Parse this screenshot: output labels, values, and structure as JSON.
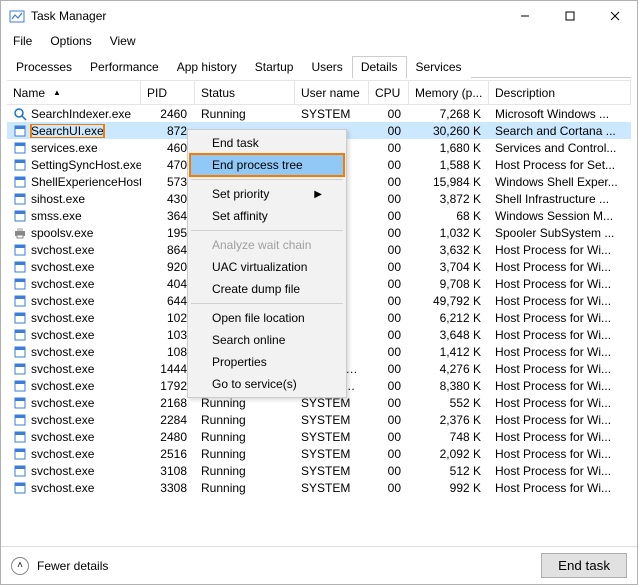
{
  "title": "Task Manager",
  "menubar": [
    "File",
    "Options",
    "View"
  ],
  "tabs": [
    "Processes",
    "Performance",
    "App history",
    "Startup",
    "Users",
    "Details",
    "Services"
  ],
  "active_tab": 5,
  "columns": [
    "Name",
    "PID",
    "Status",
    "User name",
    "CPU",
    "Memory (p...",
    "Description"
  ],
  "rows": [
    {
      "name": "SearchIndexer.exe",
      "pid": "2460",
      "status": "Running",
      "user": "SYSTEM",
      "cpu": "00",
      "mem": "7,268 K",
      "desc": "Microsoft Windows ...",
      "icon": "search"
    },
    {
      "name": "SearchUI.exe",
      "pid": "872",
      "status": "",
      "user": "",
      "cpu": "00",
      "mem": "30,260 K",
      "desc": "Search and Cortana ...",
      "icon": "app",
      "selected": true,
      "highlight": true
    },
    {
      "name": "services.exe",
      "pid": "460",
      "status": "",
      "user": "",
      "cpu": "00",
      "mem": "1,680 K",
      "desc": "Services and Control...",
      "icon": "app"
    },
    {
      "name": "SettingSyncHost.exe",
      "pid": "470",
      "status": "",
      "user": "",
      "cpu": "00",
      "mem": "1,588 K",
      "desc": "Host Process for Set...",
      "icon": "app"
    },
    {
      "name": "ShellExperienceHost....",
      "pid": "573",
      "status": "",
      "user": "",
      "cpu": "00",
      "mem": "15,984 K",
      "desc": "Windows Shell Exper...",
      "icon": "app"
    },
    {
      "name": "sihost.exe",
      "pid": "430",
      "status": "",
      "user": "",
      "cpu": "00",
      "mem": "3,872 K",
      "desc": "Shell Infrastructure ...",
      "icon": "app"
    },
    {
      "name": "smss.exe",
      "pid": "364",
      "status": "",
      "user": "",
      "cpu": "00",
      "mem": "68 K",
      "desc": "Windows Session M...",
      "icon": "app"
    },
    {
      "name": "spoolsv.exe",
      "pid": "195",
      "status": "",
      "user": "",
      "cpu": "00",
      "mem": "1,032 K",
      "desc": "Spooler SubSystem ...",
      "icon": "printer"
    },
    {
      "name": "svchost.exe",
      "pid": "864",
      "status": "",
      "user": "",
      "cpu": "00",
      "mem": "3,632 K",
      "desc": "Host Process for Wi...",
      "icon": "app"
    },
    {
      "name": "svchost.exe",
      "pid": "920",
      "status": "",
      "user": "",
      "cpu": "00",
      "mem": "3,704 K",
      "desc": "Host Process for Wi...",
      "icon": "app"
    },
    {
      "name": "svchost.exe",
      "pid": "404",
      "status": "",
      "user": "",
      "cpu": "00",
      "mem": "9,708 K",
      "desc": "Host Process for Wi...",
      "icon": "app"
    },
    {
      "name": "svchost.exe",
      "pid": "644",
      "status": "",
      "user": "",
      "cpu": "00",
      "mem": "49,792 K",
      "desc": "Host Process for Wi...",
      "icon": "app"
    },
    {
      "name": "svchost.exe",
      "pid": "102",
      "status": "",
      "user": "",
      "cpu": "00",
      "mem": "6,212 K",
      "desc": "Host Process for Wi...",
      "icon": "app"
    },
    {
      "name": "svchost.exe",
      "pid": "103",
      "status": "",
      "user": "",
      "cpu": "00",
      "mem": "3,648 K",
      "desc": "Host Process for Wi...",
      "icon": "app"
    },
    {
      "name": "svchost.exe",
      "pid": "108",
      "status": "",
      "user": "",
      "cpu": "00",
      "mem": "1,412 K",
      "desc": "Host Process for Wi...",
      "icon": "app"
    },
    {
      "name": "svchost.exe",
      "pid": "1444",
      "status": "Running",
      "user": "NETWORK...",
      "cpu": "00",
      "mem": "4,276 K",
      "desc": "Host Process for Wi...",
      "icon": "app"
    },
    {
      "name": "svchost.exe",
      "pid": "1792",
      "status": "Running",
      "user": "LOCAL SE...",
      "cpu": "00",
      "mem": "8,380 K",
      "desc": "Host Process for Wi...",
      "icon": "app"
    },
    {
      "name": "svchost.exe",
      "pid": "2168",
      "status": "Running",
      "user": "SYSTEM",
      "cpu": "00",
      "mem": "552 K",
      "desc": "Host Process for Wi...",
      "icon": "app"
    },
    {
      "name": "svchost.exe",
      "pid": "2284",
      "status": "Running",
      "user": "SYSTEM",
      "cpu": "00",
      "mem": "2,376 K",
      "desc": "Host Process for Wi...",
      "icon": "app"
    },
    {
      "name": "svchost.exe",
      "pid": "2480",
      "status": "Running",
      "user": "SYSTEM",
      "cpu": "00",
      "mem": "748 K",
      "desc": "Host Process for Wi...",
      "icon": "app"
    },
    {
      "name": "svchost.exe",
      "pid": "2516",
      "status": "Running",
      "user": "SYSTEM",
      "cpu": "00",
      "mem": "2,092 K",
      "desc": "Host Process for Wi...",
      "icon": "app"
    },
    {
      "name": "svchost.exe",
      "pid": "3108",
      "status": "Running",
      "user": "SYSTEM",
      "cpu": "00",
      "mem": "512 K",
      "desc": "Host Process for Wi...",
      "icon": "app"
    },
    {
      "name": "svchost.exe",
      "pid": "3308",
      "status": "Running",
      "user": "SYSTEM",
      "cpu": "00",
      "mem": "992 K",
      "desc": "Host Process for Wi...",
      "icon": "app"
    }
  ],
  "context_menu": {
    "items": [
      {
        "label": "End task",
        "type": "item"
      },
      {
        "label": "End process tree",
        "type": "item",
        "highlight": true,
        "outline": true
      },
      {
        "type": "sep"
      },
      {
        "label": "Set priority",
        "type": "item",
        "sub": true
      },
      {
        "label": "Set affinity",
        "type": "item"
      },
      {
        "type": "sep"
      },
      {
        "label": "Analyze wait chain",
        "type": "item",
        "disabled": true
      },
      {
        "label": "UAC virtualization",
        "type": "item"
      },
      {
        "label": "Create dump file",
        "type": "item"
      },
      {
        "type": "sep"
      },
      {
        "label": "Open file location",
        "type": "item"
      },
      {
        "label": "Search online",
        "type": "item"
      },
      {
        "label": "Properties",
        "type": "item"
      },
      {
        "label": "Go to service(s)",
        "type": "item"
      }
    ]
  },
  "footer": {
    "fewer": "Fewer details",
    "end_task": "End task"
  }
}
